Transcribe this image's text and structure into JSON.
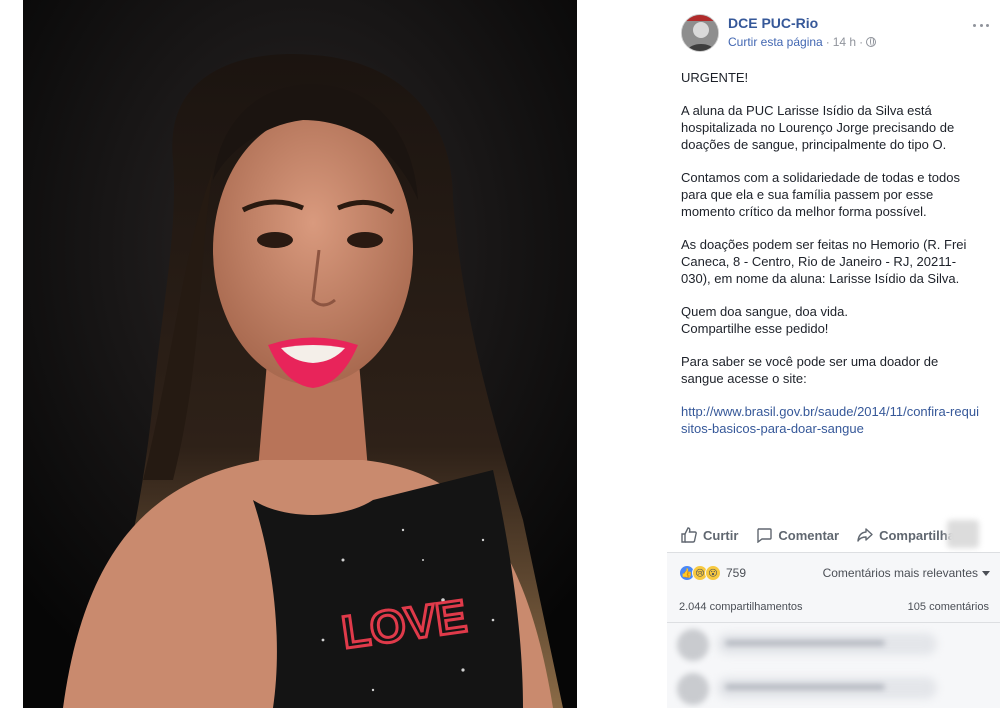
{
  "post": {
    "page_name": "DCE PUC-Rio",
    "like_page": "Curtir esta página",
    "separator": "·",
    "time": "14 h",
    "paragraphs": [
      "URGENTE!",
      "A aluna da PUC Larisse Isídio da Silva está hospitalizada no Lourenço Jorge precisando de doações de sangue, principalmente do tipo O.",
      "Contamos com a solidariedade de todas e todos para que ela e sua família passem por esse momento crítico da melhor forma possível.",
      "As doações podem ser feitas no Hemorio (R. Frei Caneca, 8 - Centro, Rio de Janeiro - RJ, 20211-030), em nome da aluna: Larisse Isídio da Silva.",
      "Quem doa sangue, doa vida.",
      "Compartilhe esse pedido!",
      "Para saber se você pode ser uma doador de sangue acesse o site:"
    ],
    "link": "http://www.brasil.gov.br/saude/2014/11/confira-requisitos-basicos-para-doar-sangue"
  },
  "actions": {
    "like": "Curtir",
    "comment": "Comentar",
    "share": "Compartilhar"
  },
  "stats": {
    "reaction_count": "759",
    "sort_label": "Comentários mais relevantes",
    "shares": "2.044 compartilhamentos",
    "comments": "105 comentários"
  },
  "photo": {
    "shirt_text": "LOVE"
  },
  "colors": {
    "link": "#365899",
    "meta": "#90949c",
    "like_blue": "#4a88f5",
    "lips": "#e8245a"
  }
}
